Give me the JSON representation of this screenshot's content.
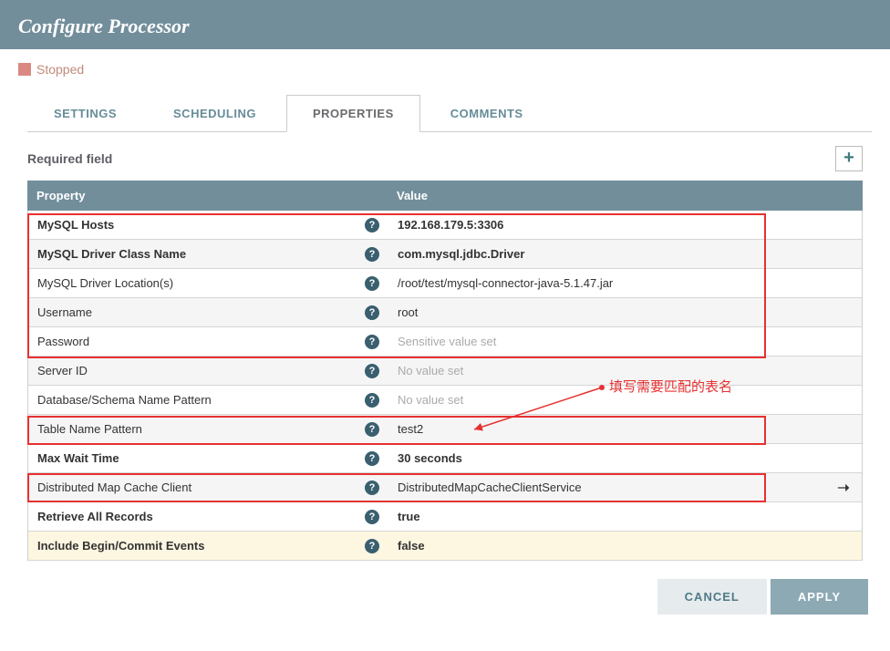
{
  "header": {
    "title": "Configure Processor"
  },
  "status": {
    "label": "Stopped"
  },
  "tabs": {
    "settings": "SETTINGS",
    "scheduling": "SCHEDULING",
    "properties": "PROPERTIES",
    "comments": "COMMENTS"
  },
  "required_label": "Required field",
  "table": {
    "head_property": "Property",
    "head_value": "Value",
    "rows": [
      {
        "name": "MySQL Hosts",
        "bold": true,
        "value": "192.168.179.5:3306",
        "vbold": true,
        "dim": false,
        "service": false,
        "hl": false
      },
      {
        "name": "MySQL Driver Class Name",
        "bold": true,
        "value": "com.mysql.jdbc.Driver",
        "vbold": true,
        "dim": false,
        "service": false,
        "hl": false
      },
      {
        "name": "MySQL Driver Location(s)",
        "bold": false,
        "value": "/root/test/mysql-connector-java-5.1.47.jar",
        "vbold": false,
        "dim": false,
        "service": false,
        "hl": false
      },
      {
        "name": "Username",
        "bold": false,
        "value": "root",
        "vbold": false,
        "dim": false,
        "service": false,
        "hl": false
      },
      {
        "name": "Password",
        "bold": false,
        "value": "Sensitive value set",
        "vbold": false,
        "dim": true,
        "service": false,
        "hl": false
      },
      {
        "name": "Server ID",
        "bold": false,
        "value": "No value set",
        "vbold": false,
        "dim": true,
        "service": false,
        "hl": false
      },
      {
        "name": "Database/Schema Name Pattern",
        "bold": false,
        "value": "No value set",
        "vbold": false,
        "dim": true,
        "service": false,
        "hl": false
      },
      {
        "name": "Table Name Pattern",
        "bold": false,
        "value": "test2",
        "vbold": false,
        "dim": false,
        "service": false,
        "hl": false
      },
      {
        "name": "Max Wait Time",
        "bold": true,
        "value": "30 seconds",
        "vbold": true,
        "dim": false,
        "service": false,
        "hl": false
      },
      {
        "name": "Distributed Map Cache Client",
        "bold": false,
        "value": "DistributedMapCacheClientService",
        "vbold": false,
        "dim": false,
        "service": true,
        "hl": false
      },
      {
        "name": "Retrieve All Records",
        "bold": true,
        "value": "true",
        "vbold": true,
        "dim": false,
        "service": false,
        "hl": false
      },
      {
        "name": "Include Begin/Commit Events",
        "bold": true,
        "value": "false",
        "vbold": true,
        "dim": false,
        "service": false,
        "hl": true
      }
    ]
  },
  "footer": {
    "cancel": "CANCEL",
    "apply": "APPLY"
  },
  "annotation": {
    "text": "填写需要匹配的表名"
  }
}
